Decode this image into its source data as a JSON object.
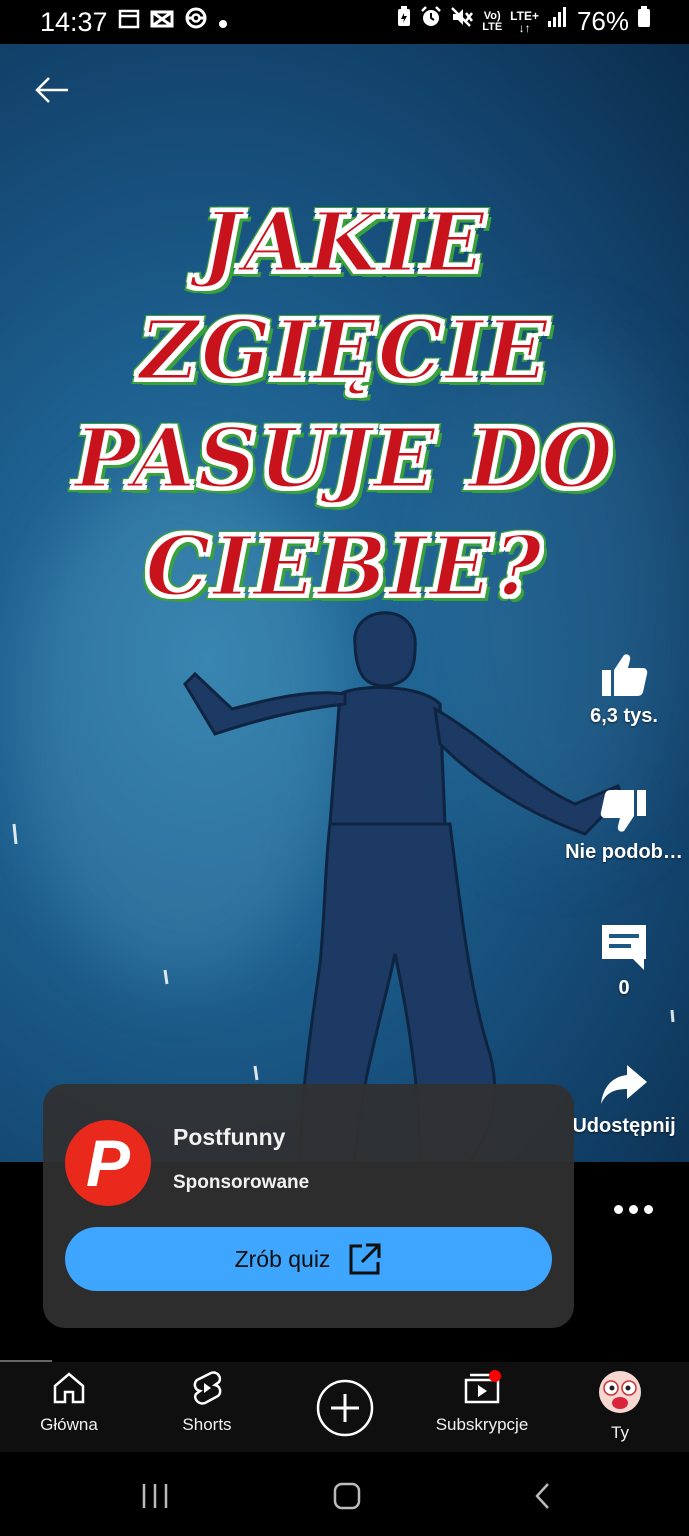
{
  "status_bar": {
    "time": "14:37",
    "battery_percent": "76%",
    "network_label": "LTE+",
    "volte_label": "VoLTE",
    "left_icons": [
      "calendar-icon",
      "mail-icon",
      "pokeball-icon",
      "dot-icon"
    ],
    "right_icons": [
      "battery-saver-icon",
      "alarm-icon",
      "mute-icon",
      "volte-icon",
      "lte-icon",
      "signal-icon",
      "battery-icon"
    ]
  },
  "video": {
    "title_lines": [
      "JAKIE ZGIĘCIE",
      "PASUJE DO",
      "CIEBIE?"
    ]
  },
  "actions": {
    "like_count": "6,3 tys.",
    "dislike_label": "Nie podob…",
    "comments_count": "0",
    "share_label": "Udostępnij"
  },
  "ad": {
    "channel_name": "Postfunny",
    "sponsored_label": "Sponsorowane",
    "cta_label": "Zrób quiz",
    "logo_letter": "P"
  },
  "bottom_nav": {
    "items": [
      {
        "label": "Główna",
        "icon": "home-icon"
      },
      {
        "label": "Shorts",
        "icon": "shorts-icon"
      },
      {
        "label": "",
        "icon": "create-icon"
      },
      {
        "label": "Subskrypcje",
        "icon": "subscriptions-icon"
      },
      {
        "label": "Ty",
        "icon": "avatar"
      }
    ]
  },
  "colors": {
    "accent": "#3ea6ff",
    "ad_logo": "#e8291c",
    "title_red": "#c8121c",
    "notification_dot": "#ff0000"
  }
}
